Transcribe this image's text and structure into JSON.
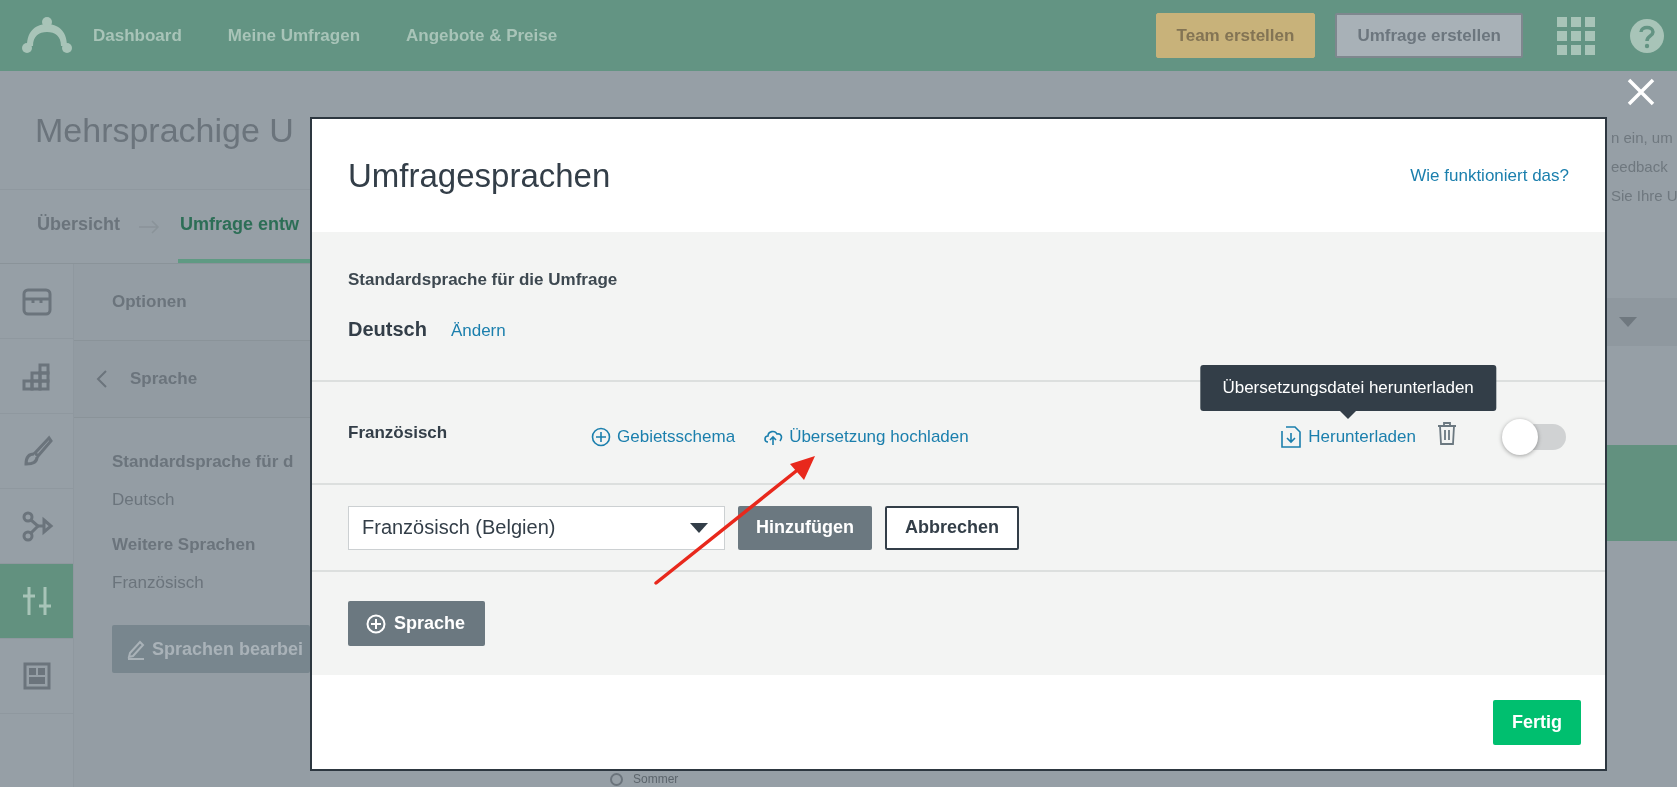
{
  "header": {
    "nav": [
      {
        "label": "Dashboard"
      },
      {
        "label": "Meine Umfragen"
      },
      {
        "label": "Angebote & Preise"
      }
    ],
    "buttons": [
      {
        "label": "Team erstellen",
        "kind": "accent"
      },
      {
        "label": "Umfrage erstellen",
        "kind": "outline"
      }
    ]
  },
  "page": {
    "title": "Mehrsprachige U",
    "steps": [
      {
        "label": "Übersicht",
        "selected": false
      },
      {
        "label": "Umfrage entw",
        "selected": true
      }
    ],
    "tool_rail": [
      {
        "kind": "library",
        "selected": false
      },
      {
        "kind": "chart",
        "selected": false
      },
      {
        "kind": "brush",
        "selected": false
      },
      {
        "kind": "logic",
        "selected": false
      },
      {
        "kind": "options",
        "selected": true
      },
      {
        "kind": "layout",
        "selected": false
      }
    ],
    "panel": {
      "heading": "Optionen",
      "back_label": "Sprache",
      "default_label": "Standardsprache für d",
      "default_value": "Deutsch",
      "more_label": "Weitere Sprachen",
      "more_value": "Französisch",
      "edit_button": "Sprachen bearbei"
    },
    "canvas": {
      "option": "Sommer",
      "selected": false
    },
    "side": {
      "lines": [
        "n ein, um",
        "eedback",
        "Sie Ihre U"
      ]
    }
  },
  "modal": {
    "title": "Umfragesprachen",
    "help_link": "Wie funktioniert das?",
    "default_label": "Standardsprache für die Umfrage",
    "default_language": "Deutsch",
    "change_link": "Ändern",
    "languages": [
      {
        "name": "Französisch",
        "locale_link": "Gebietsschema",
        "upload_link": "Übersetzung hochladen",
        "download_link": "Herunterladen",
        "tooltip": "Übersetzungsdatei herunterladen",
        "on": false
      }
    ],
    "add_row": {
      "value": "Französisch (Belgien)",
      "add_button": "Hinzufügen",
      "cancel_button": "Abbrechen"
    },
    "add_language_button": "Sprache",
    "done_button": "Fertig"
  }
}
